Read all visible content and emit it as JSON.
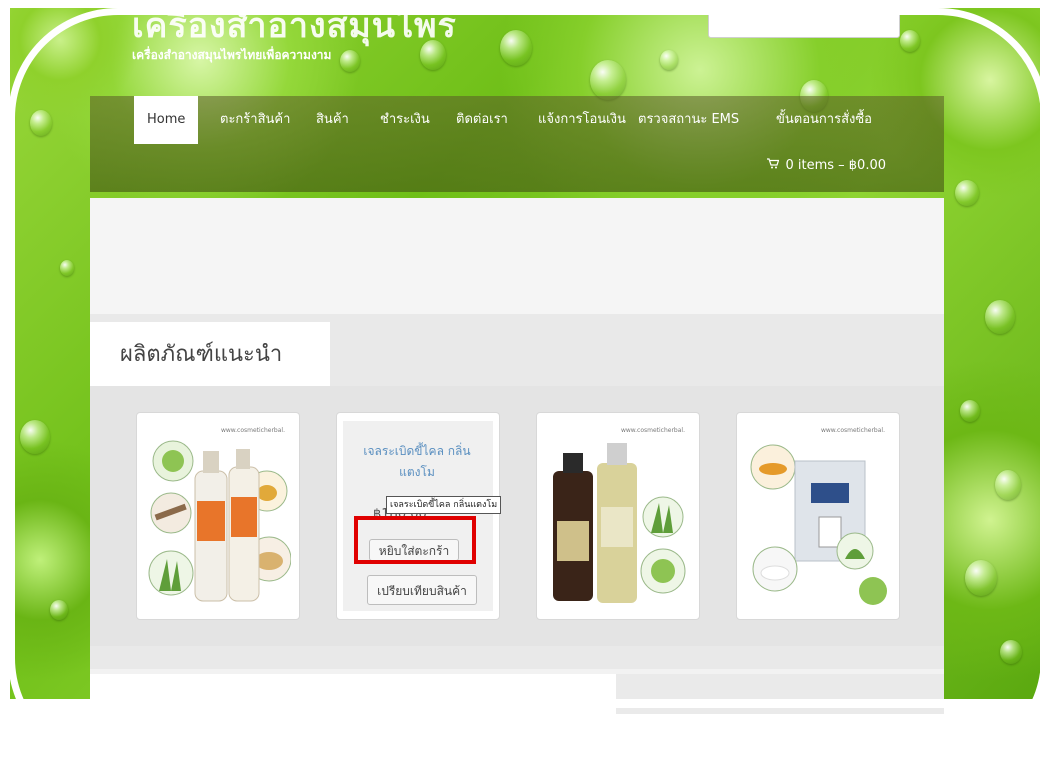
{
  "site": {
    "title": "เครื่องสำอางสมุนไพร",
    "tagline": "เครื่องสำอางสมุนไพรไทยเพื่อความงาม"
  },
  "nav": {
    "items": [
      {
        "label": "Home",
        "active": true
      },
      {
        "label": "ตะกร้าสินค้า"
      },
      {
        "label": "สินค้า"
      },
      {
        "label": "ชำระเงิน"
      },
      {
        "label": "ติดต่อเรา"
      },
      {
        "label": "แจ้งการโอนเงิน"
      },
      {
        "label": "ตรวจสถานะ EMS"
      },
      {
        "label": "ขั้นตอนการสั่งซื้อ"
      }
    ],
    "cart": {
      "icon": "cart-icon",
      "label": "0 items – ฿0.00"
    }
  },
  "featured": {
    "title": "ผลิตภัณฑ์แนะนำ",
    "products": [
      {
        "watermark": "www.cosmeticherbal.",
        "image": "herbal-lotion-bottles"
      },
      {
        "name": "เจลระเบิดขี้ไคล กลิ่นแตงโม",
        "price": "฿180.00",
        "add_to_cart": "หยิบใส่ตะกร้า",
        "compare": "เปรียบเทียบสินค้า",
        "tooltip": "เจลระเบิดขี้ไคล กลิ่นแตงโม"
      },
      {
        "watermark": "www.cosmeticherbal.",
        "image": "herbal-shampoo-bottles"
      },
      {
        "watermark": "www.cosmeticherbal.",
        "image": "herbal-powder-pack"
      }
    ]
  },
  "colors": {
    "accent_green": "#6fbf18",
    "highlight_red": "#e00000",
    "link_blue": "#5a8fc0"
  }
}
